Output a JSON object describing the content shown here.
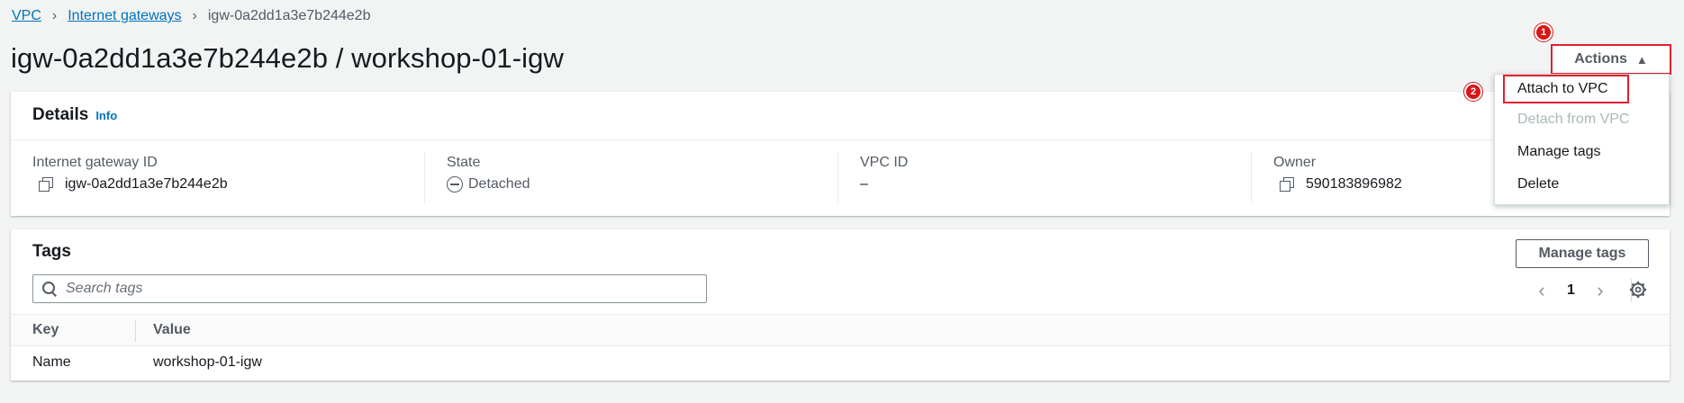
{
  "breadcrumb": {
    "vpc": "VPC",
    "internet_gateways": "Internet gateways",
    "current": "igw-0a2dd1a3e7b244e2b"
  },
  "page_title": "igw-0a2dd1a3e7b244e2b / workshop-01-igw",
  "actions": {
    "label": "Actions",
    "caret": "▲",
    "menu": [
      {
        "label": "Attach to VPC",
        "enabled": true
      },
      {
        "label": "Detach from VPC",
        "enabled": false
      },
      {
        "label": "Manage tags",
        "enabled": true
      },
      {
        "label": "Delete",
        "enabled": true
      }
    ]
  },
  "markers": [
    "1",
    "2"
  ],
  "details": {
    "title": "Details",
    "info": "Info",
    "fields": [
      {
        "label": "Internet gateway ID",
        "value": "igw-0a2dd1a3e7b244e2b"
      },
      {
        "label": "State",
        "value": "Detached"
      },
      {
        "label": "VPC ID",
        "value": "–"
      },
      {
        "label": "Owner",
        "value": "590183896982"
      }
    ]
  },
  "tags": {
    "title": "Tags",
    "manage_label": "Manage tags",
    "search_placeholder": "Search tags",
    "page": "1",
    "columns": [
      "Key",
      "Value"
    ],
    "rows": [
      {
        "key": "Name",
        "value": "workshop-01-igw"
      }
    ]
  },
  "colors": {
    "link": "#0073bb",
    "highlight_border": "#e0202e",
    "marker": "#d91515",
    "background": "#f2f3f3"
  }
}
